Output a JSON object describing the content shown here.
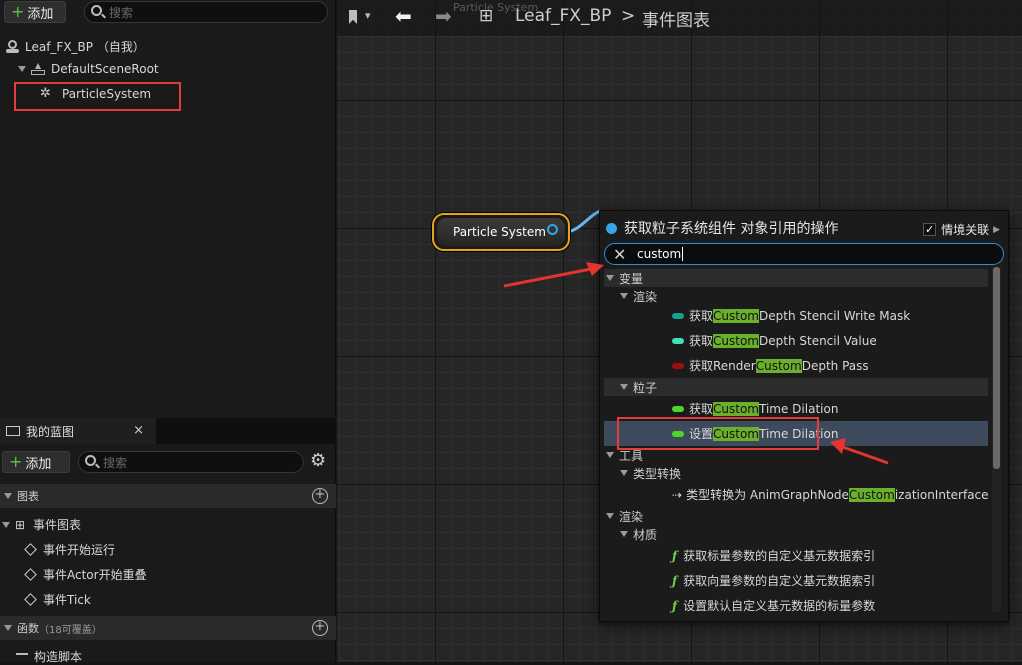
{
  "left_panel": {
    "add_label": "添加",
    "search_placeholder": "搜索",
    "component_tree": {
      "root": "Leaf_FX_BP （自我）",
      "scene_root": "DefaultSceneRoot",
      "particle": "ParticleSystem"
    },
    "my_blueprint": {
      "tab_label": "我的蓝图",
      "add_label": "添加",
      "search_placeholder": "搜索",
      "graphs_header": "图表",
      "event_graph": "事件图表",
      "events": [
        "事件开始运行",
        "事件Actor开始重叠",
        "事件Tick"
      ],
      "functions_header": "函数",
      "functions_override": "（18可覆盖）",
      "construct": "构造脚本"
    }
  },
  "topbar": {
    "breadcrumb_blueprint": "Leaf_FX_BP",
    "breadcrumb_separator": ">",
    "breadcrumb_graph": "事件图表",
    "ghost_label": "Particle System"
  },
  "graph": {
    "node_title": "Particle System"
  },
  "action_menu": {
    "title": "获取粒子系统组件 对象引用的操作",
    "context_label": "情境关联",
    "context_checked": "✓",
    "search_value": "custom",
    "rows": [
      {
        "kind": "cat",
        "level": 0,
        "label": "变量",
        "bg": true
      },
      {
        "kind": "cat",
        "level": 1,
        "label": "渲染"
      },
      {
        "kind": "item",
        "level": 2,
        "pill": "#1b9e8c",
        "pre": "获取",
        "hl": "Custom",
        "post": " Depth Stencil Write Mask"
      },
      {
        "kind": "item",
        "level": 2,
        "pill": "#3fe1b8",
        "pre": "获取",
        "hl": "Custom",
        "post": "Depth Stencil Value"
      },
      {
        "kind": "item",
        "level": 2,
        "pill": "#9b1010",
        "pre": "获取Render ",
        "hl": "Custom",
        "post": "Depth Pass"
      },
      {
        "kind": "cat",
        "level": 1,
        "label": "粒子",
        "bg": true
      },
      {
        "kind": "item",
        "level": 2,
        "pill": "#4fd429",
        "pre": "获取",
        "hl": "Custom",
        "post": " Time Dilation"
      },
      {
        "kind": "item",
        "level": 2,
        "pill": "#4fd429",
        "pre": "设置 ",
        "hl": "Custom",
        "post": " Time Dilation",
        "sel": true
      },
      {
        "kind": "cat",
        "level": 0,
        "label": "工具"
      },
      {
        "kind": "cat",
        "level": 1,
        "label": "类型转换"
      },
      {
        "kind": "item",
        "level": 2,
        "icon": "cast",
        "pre": "类型转换为 AnimGraphNode",
        "hl": "Custom",
        "post": "izationInterface"
      },
      {
        "kind": "cat",
        "level": 0,
        "label": "渲染"
      },
      {
        "kind": "cat",
        "level": 1,
        "label": "材质"
      },
      {
        "kind": "item",
        "level": 2,
        "icon": "func",
        "pre": "获取标量参数的自定义基元数据索引"
      },
      {
        "kind": "item",
        "level": 2,
        "icon": "func",
        "pre": "获取向量参数的自定义基元数据索引"
      },
      {
        "kind": "item",
        "level": 2,
        "icon": "func",
        "pre": "设置默认自定义基元数据的标量参数"
      }
    ]
  },
  "colors": {
    "highlight": "#6bb02d",
    "accent": "#33a6e8",
    "annotation": "#e43b3b",
    "node_border": "#e7a41a"
  }
}
